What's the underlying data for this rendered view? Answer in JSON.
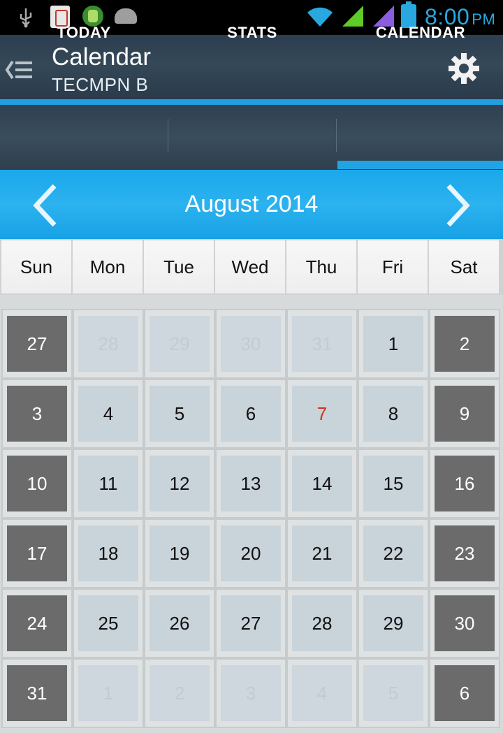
{
  "status_bar": {
    "time": "8:00",
    "ampm": "PM",
    "colors": {
      "accent": "#29a8e0",
      "signal": "#5fcb27",
      "signal2": "#8a5ce0"
    }
  },
  "action_bar": {
    "title": "Calendar",
    "subtitle": "TECMPN B"
  },
  "tabs": [
    {
      "label": "TODAY"
    },
    {
      "label": "STATS"
    },
    {
      "label": "CALENDAR",
      "selected": true
    }
  ],
  "month_header": {
    "title": "August 2014"
  },
  "weekdays": [
    "Sun",
    "Mon",
    "Tue",
    "Wed",
    "Thu",
    "Fri",
    "Sat"
  ],
  "calendar": {
    "weeks": [
      [
        {
          "d": "27",
          "kind": "weekend"
        },
        {
          "d": "28",
          "kind": "faded"
        },
        {
          "d": "29",
          "kind": "faded"
        },
        {
          "d": "30",
          "kind": "faded"
        },
        {
          "d": "31",
          "kind": "faded"
        },
        {
          "d": "1",
          "kind": "normal"
        },
        {
          "d": "2",
          "kind": "weekend"
        }
      ],
      [
        {
          "d": "3",
          "kind": "weekend"
        },
        {
          "d": "4",
          "kind": "normal"
        },
        {
          "d": "5",
          "kind": "normal"
        },
        {
          "d": "6",
          "kind": "normal"
        },
        {
          "d": "7",
          "kind": "today"
        },
        {
          "d": "8",
          "kind": "normal"
        },
        {
          "d": "9",
          "kind": "weekend"
        }
      ],
      [
        {
          "d": "10",
          "kind": "weekend"
        },
        {
          "d": "11",
          "kind": "normal"
        },
        {
          "d": "12",
          "kind": "normal"
        },
        {
          "d": "13",
          "kind": "normal"
        },
        {
          "d": "14",
          "kind": "normal"
        },
        {
          "d": "15",
          "kind": "normal"
        },
        {
          "d": "16",
          "kind": "weekend"
        }
      ],
      [
        {
          "d": "17",
          "kind": "weekend"
        },
        {
          "d": "18",
          "kind": "normal"
        },
        {
          "d": "19",
          "kind": "normal"
        },
        {
          "d": "20",
          "kind": "normal"
        },
        {
          "d": "21",
          "kind": "normal"
        },
        {
          "d": "22",
          "kind": "normal"
        },
        {
          "d": "23",
          "kind": "weekend"
        }
      ],
      [
        {
          "d": "24",
          "kind": "weekend"
        },
        {
          "d": "25",
          "kind": "normal"
        },
        {
          "d": "26",
          "kind": "normal"
        },
        {
          "d": "27",
          "kind": "normal"
        },
        {
          "d": "28",
          "kind": "normal"
        },
        {
          "d": "29",
          "kind": "normal"
        },
        {
          "d": "30",
          "kind": "weekend"
        }
      ],
      [
        {
          "d": "31",
          "kind": "weekend"
        },
        {
          "d": "1",
          "kind": "faded"
        },
        {
          "d": "2",
          "kind": "faded"
        },
        {
          "d": "3",
          "kind": "faded"
        },
        {
          "d": "4",
          "kind": "faded"
        },
        {
          "d": "5",
          "kind": "faded"
        },
        {
          "d": "6",
          "kind": "weekend"
        }
      ]
    ]
  },
  "icons": {
    "back": "drawer-back-icon",
    "settings": "gear-icon",
    "prev": "chevron-left-icon",
    "next": "chevron-right-icon"
  }
}
